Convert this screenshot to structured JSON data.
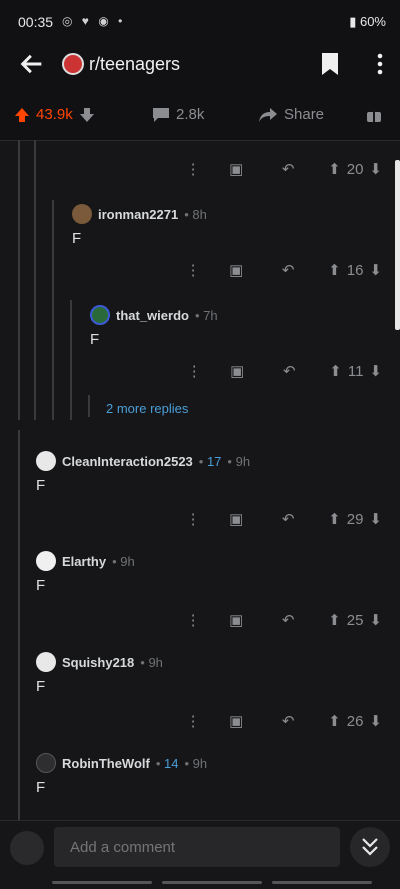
{
  "status": {
    "time": "00:35",
    "icons": "◎ ♥ ◉ •",
    "battery": "60%"
  },
  "header": {
    "subreddit": "r/teenagers"
  },
  "post_actions": {
    "upvotes": "43.9k",
    "comments": "2.8k",
    "share": "Share"
  },
  "comments": [
    {
      "votes": "20"
    },
    {
      "user": "ironman2271",
      "karma": "",
      "age": "8h",
      "text": "F",
      "votes": "16"
    },
    {
      "user": "that_wierdo",
      "karma": "",
      "age": "7h",
      "text": "F",
      "votes": "11"
    },
    {
      "user": "CleanInteraction2523",
      "karma": "17",
      "age": "9h",
      "text": "F",
      "votes": "29"
    },
    {
      "user": "Elarthy",
      "karma": "",
      "age": "9h",
      "text": "F",
      "votes": "25"
    },
    {
      "user": "Squishy218",
      "karma": "",
      "age": "9h",
      "text": "F",
      "votes": "26"
    },
    {
      "user": "RobinTheWolf",
      "karma": "14",
      "age": "9h",
      "text": "F",
      "votes": ""
    }
  ],
  "more_replies": "2 more replies",
  "composer": {
    "placeholder": "Add a comment"
  },
  "colors": {
    "accent": "#ff4500",
    "link": "#4a9ed8",
    "bg": "#161618"
  }
}
